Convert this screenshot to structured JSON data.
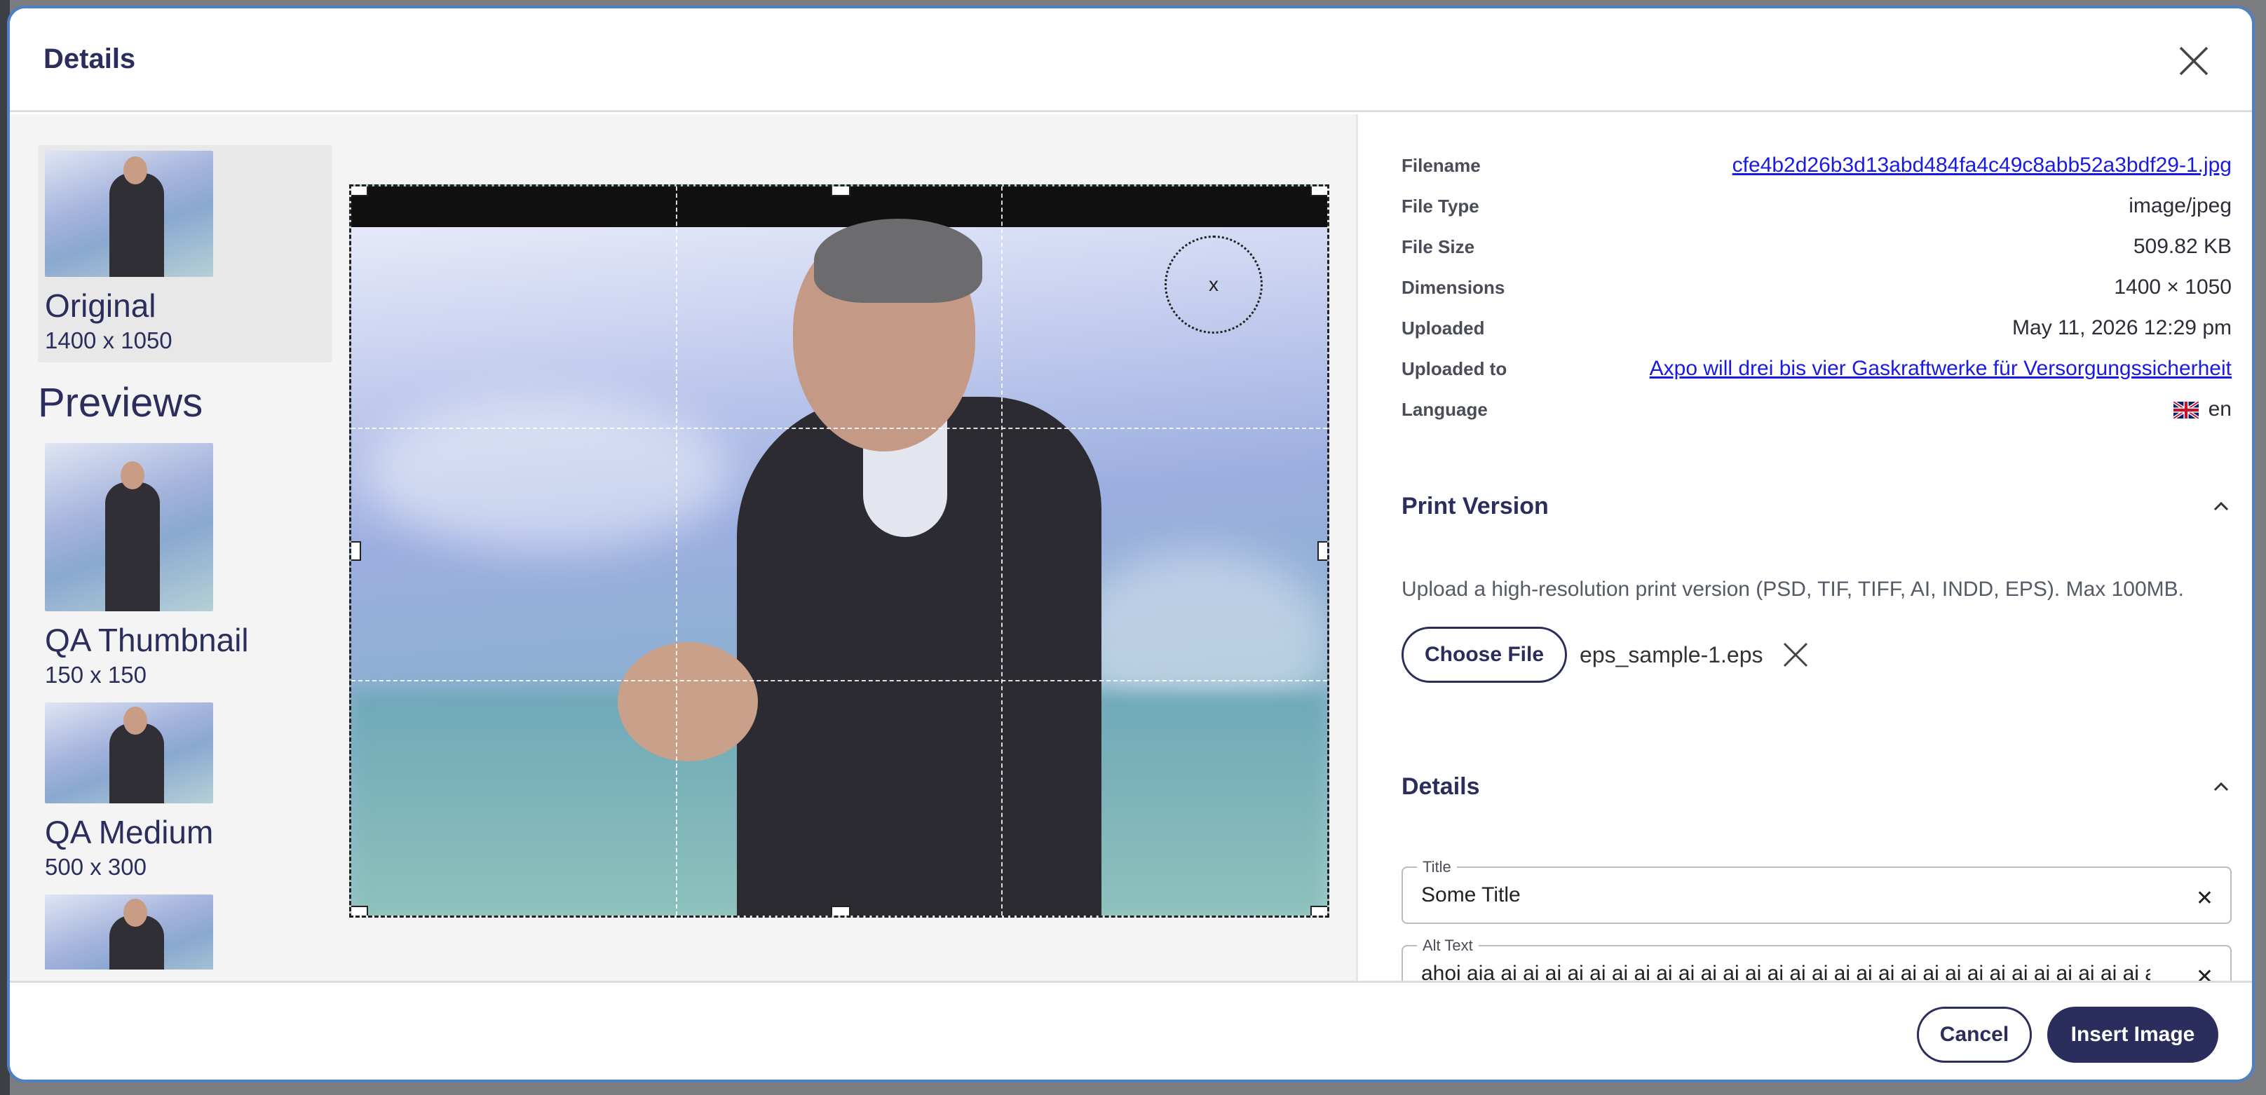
{
  "modal": {
    "title": "Details"
  },
  "variants": {
    "original": {
      "name": "Original",
      "size": "1400 x 1050"
    },
    "previews_heading": "Previews",
    "items": [
      {
        "name": "QA Thumbnail",
        "size": "150 x 150"
      },
      {
        "name": "QA Medium",
        "size": "500 x 300"
      }
    ]
  },
  "crop": {
    "focus_label": "x"
  },
  "meta": {
    "filename_label": "Filename",
    "filename_value": "cfe4b2d26b3d13abd484fa4c49c8abb52a3bdf29-1.jpg",
    "filetype_label": "File Type",
    "filetype_value": "image/jpeg",
    "filesize_label": "File Size",
    "filesize_value": "509.82 KB",
    "dimensions_label": "Dimensions",
    "dimensions_value": "1400 × 1050",
    "uploaded_label": "Uploaded",
    "uploaded_value": "May 11, 2026 12:29 pm",
    "uploadedto_label": "Uploaded to",
    "uploadedto_value": "Axpo will drei bis vier Gaskraftwerke für Versorgungssicherheit",
    "language_label": "Language",
    "language_value": "en"
  },
  "print_version": {
    "title": "Print Version",
    "description": "Upload a high-resolution print version (PSD, TIF, TIFF, AI, INDD, EPS). Max 100MB.",
    "choose_label": "Choose File",
    "file_name": "eps_sample-1.eps"
  },
  "details": {
    "title": "Details",
    "title_field_label": "Title",
    "title_field_value": "Some Title",
    "alt_field_label": "Alt Text",
    "alt_field_value": "ahoi aia ai ai ai ai ai ai ai ai ai ai ai ai ai ai ai ai ai ai ai ai ai ai ai ai ai ai ai ai ai ai ai ai ai ai ai"
  },
  "footer": {
    "cancel_label": "Cancel",
    "insert_label": "Insert Image"
  },
  "colors": {
    "primary": "#2b2d5c",
    "link": "#1a1ae6",
    "modal_border": "#4f7fc4"
  }
}
